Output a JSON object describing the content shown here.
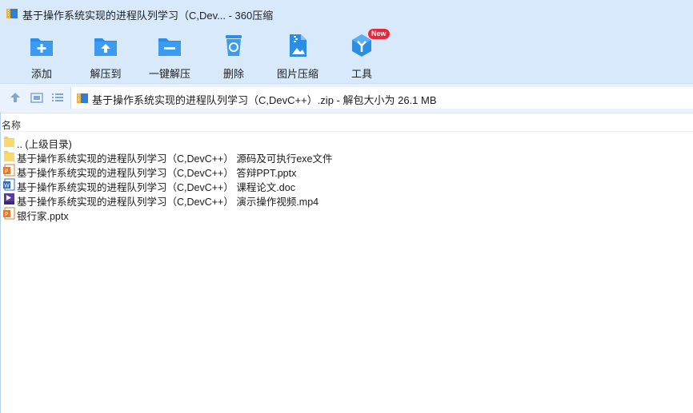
{
  "window": {
    "title": "基于操作系统实现的进程队列学习（C,Dev... - 360压缩"
  },
  "toolbar": {
    "items": [
      {
        "label": "添加",
        "icon": "add-folder-icon"
      },
      {
        "label": "解压到",
        "icon": "extract-to-icon"
      },
      {
        "label": "一键解压",
        "icon": "one-click-extract-icon"
      },
      {
        "label": "删除",
        "icon": "recycle-bin-icon"
      },
      {
        "label": "图片压缩",
        "icon": "image-compress-icon"
      },
      {
        "label": "工具",
        "icon": "tools-icon",
        "badge": "New"
      }
    ]
  },
  "address": {
    "path": "基于操作系统实现的进程队列学习（C,DevC++）.zip - 解包大小为 26.1 MB"
  },
  "list": {
    "column_name": "名称",
    "items": [
      {
        "name": ".. (上级目录)",
        "icon": "parent-folder-icon"
      },
      {
        "name": "基于操作系统实现的进程队列学习（C,DevC++）  源码及可执行exe文件",
        "icon": "folder-icon"
      },
      {
        "name": "基于操作系统实现的进程队列学习（C,DevC++）  答辩PPT.pptx",
        "icon": "pptx-icon"
      },
      {
        "name": "基于操作系统实现的进程队列学习（C,DevC++）  课程论文.doc",
        "icon": "doc-icon"
      },
      {
        "name": "基于操作系统实现的进程队列学习（C,DevC++）  演示操作视频.mp4",
        "icon": "mp4-icon"
      },
      {
        "name": "银行家.pptx",
        "icon": "pptx-icon"
      }
    ]
  },
  "colors": {
    "toolbar_bg": "#d7e9fb",
    "icon_blue": "#2b8de3",
    "badge_red": "#e8283a"
  }
}
